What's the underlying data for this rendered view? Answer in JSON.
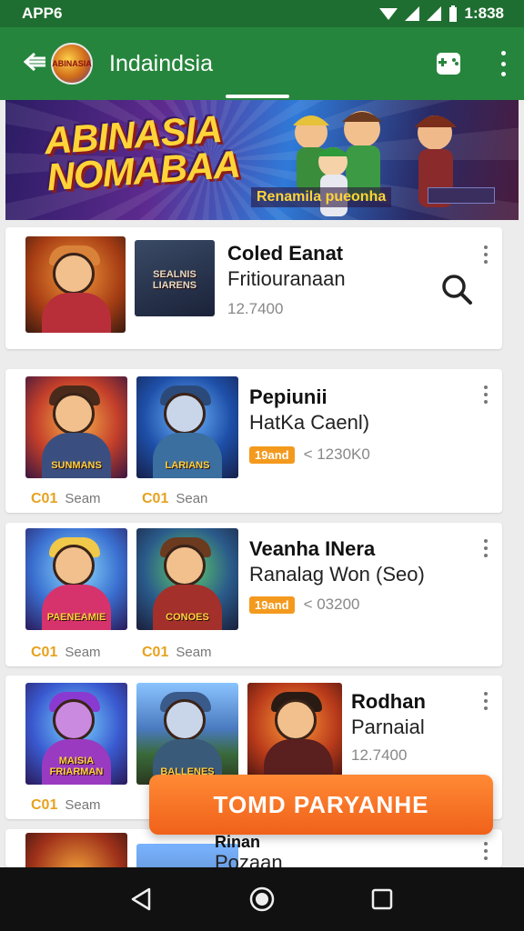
{
  "status_bar": {
    "app_label": "APP6",
    "time": "1:838",
    "icons": [
      "wifi-icon",
      "signal-icon",
      "signal-icon",
      "battery-icon"
    ]
  },
  "app_bar": {
    "title": "Indaindsia",
    "logo_text": "ABINASIA",
    "icons": [
      "back-icon",
      "gamepad-icon",
      "more-vert-icon"
    ]
  },
  "banner": {
    "title_line1": "ABINASIA",
    "title_line2": "NOMABAA",
    "subtitle": "Renamila pueonha"
  },
  "featured": {
    "title": "Coled Eanat",
    "subtitle": "Fritiouranaan",
    "meta": "12.7400",
    "thumb2_caption": "SEALNIS LIARENS"
  },
  "cards": [
    {
      "title": "Pepiunii",
      "subtitle": "HatKa Caenl)",
      "badge": "19and",
      "meta": "< 1230K0",
      "thumb1_caption": "SUNMANS",
      "thumb2_caption": "LARIANS",
      "label1": "Seam",
      "label2": "Sean",
      "counter": "C01"
    },
    {
      "title": "Veanha INera",
      "subtitle": "Ranalag Won (Seo)",
      "badge": "19and",
      "meta": "< 03200",
      "thumb1_caption": "PAENEAMIE",
      "thumb2_caption": "CONOES",
      "label1": "Seam",
      "label2": "Seam",
      "counter": "C01"
    },
    {
      "title": "Rodhan",
      "subtitle": "Parnaial",
      "meta": "12.7400",
      "thumb1_caption": "MAISIA FRIARMAN",
      "thumb2_caption": "BALLENES",
      "label1": "Seam",
      "counter": "C01"
    },
    {
      "title": "Rinan",
      "subtitle": "Pozaan"
    }
  ],
  "cta": {
    "label": "TOMD   PARYANHE"
  },
  "colors": {
    "status_bar": "#1f6e31",
    "app_bar": "#26853c",
    "cta": "#f0611a",
    "badge": "#f39a1e"
  }
}
